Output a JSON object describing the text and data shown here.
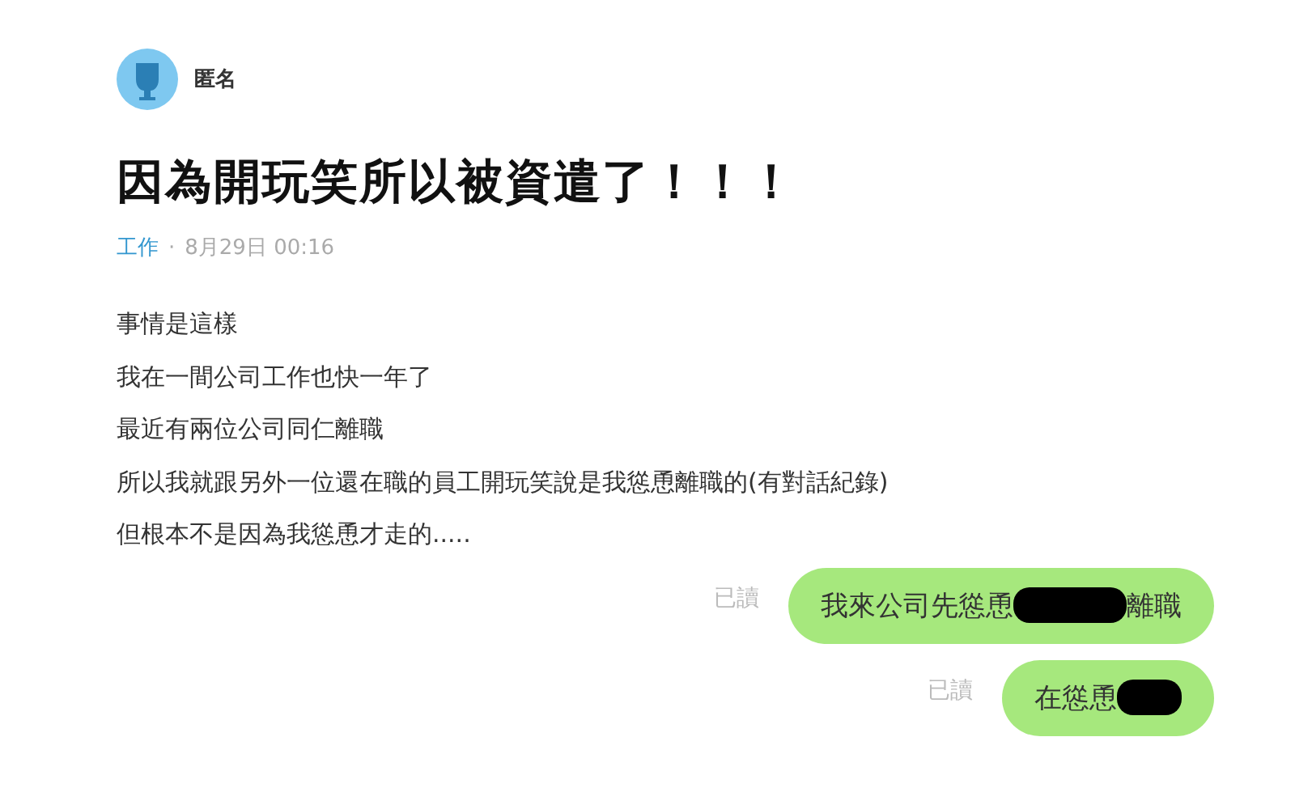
{
  "author": {
    "name": "匿名"
  },
  "post": {
    "title": "因為開玩笑所以被資遣了！！！",
    "category": "工作",
    "separator": "·",
    "date": "8月29日 00:16",
    "body": [
      "事情是這樣",
      "我在一間公司工作也快一年了",
      "最近有兩位公司同仁離職",
      "所以我就跟另外一位還在職的員工開玩笑說是我慫恿離職的(有對話紀錄)",
      "但根本不是因為我慫恿才走的....."
    ]
  },
  "chat": [
    {
      "status": "已讀",
      "text_before": "我來公司先慫恿",
      "redacted": true,
      "text_after": "離職"
    },
    {
      "status": "已讀",
      "text_before": "在慫恿",
      "redacted": true
    }
  ]
}
